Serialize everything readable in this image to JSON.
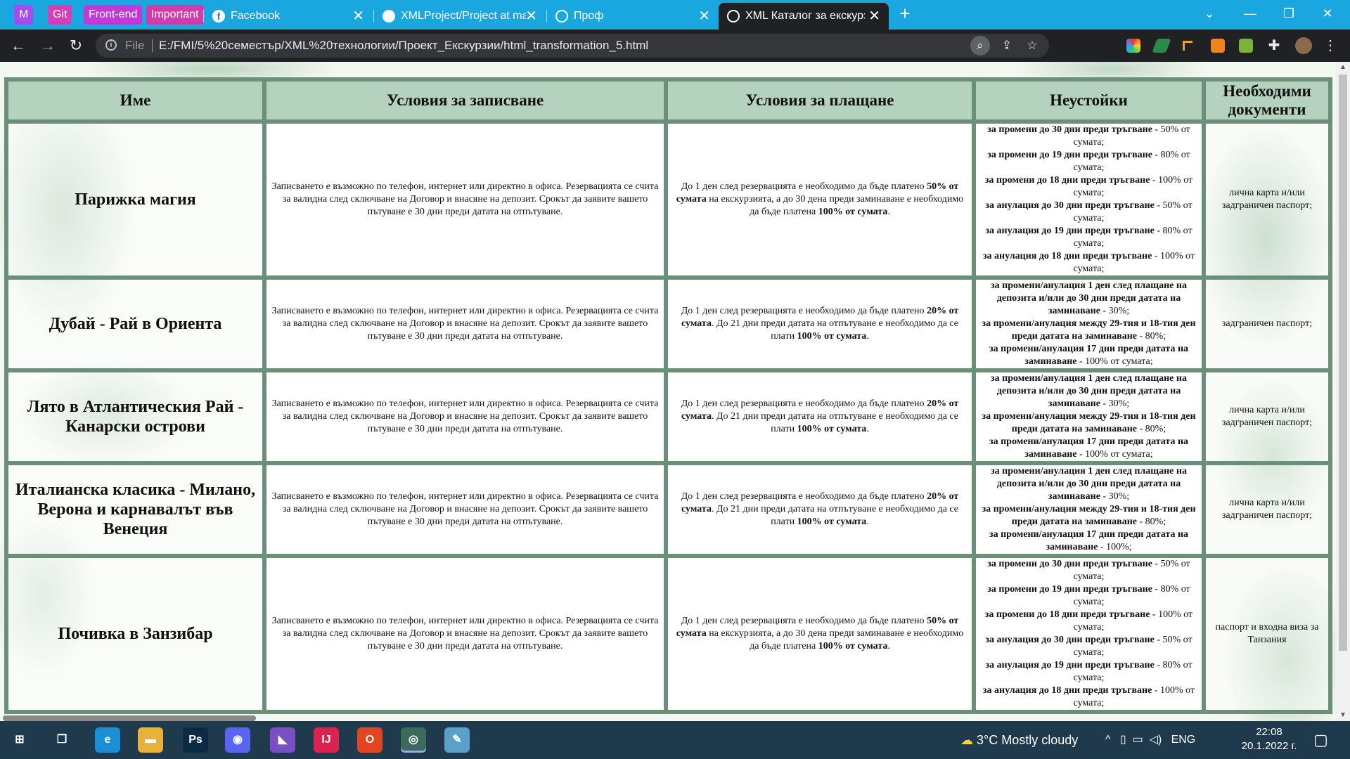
{
  "browser": {
    "bookmarks": [
      {
        "label": "M",
        "color": "#a64bf4"
      },
      {
        "label": "Git",
        "color": "#d63eb8"
      },
      {
        "label": "Front-end",
        "color": "#c239d9"
      },
      {
        "label": "Important",
        "color": "#d13cad"
      }
    ],
    "tabs": [
      {
        "title": "Facebook",
        "icon": "facebook-icon",
        "active": false
      },
      {
        "title": "XMLProject/Project at main · Vesi",
        "icon": "github-icon",
        "active": false
      },
      {
        "title": "Проф",
        "icon": "globe-icon",
        "active": false
      },
      {
        "title": "XML Каталог за екскурзии",
        "icon": "globe-icon",
        "active": true
      }
    ],
    "new_tab": "+",
    "close_glyph": "✕",
    "window_controls": [
      "⌄",
      "—",
      "❐",
      "✕"
    ],
    "nav": {
      "back": "←",
      "forward": "→",
      "reload": "↻"
    },
    "address": {
      "scheme_label": "File",
      "url": "E:/FMI/5%20семестър/XML%20технологии/Проект_Екскурзии/html_transformation_5.html"
    }
  },
  "table": {
    "headers": [
      "Име",
      "Условия за записване",
      "Условия за плащане",
      "Неустойки",
      "Необходими документи"
    ],
    "rows": [
      {
        "name": "Парижка магия",
        "enrollment": "Записването е възможно по телефон, интернет или директно в офиса. Резервацията се счита за валидна след сключване на Договор и внасяне на депозит. Срокът да заявите вашето пътуване е 30 дни преди датата на отпътуване.",
        "payment": [
          {
            "t": "До 1 ден след резервацията е необходимо да бъде платено "
          },
          {
            "t": "50% от сумата",
            "b": true
          },
          {
            "t": " на екскурзията, а до 30 дена преди заминаване е необходимо да бъде платена "
          },
          {
            "t": "100% от сумата",
            "b": true
          },
          {
            "t": "."
          }
        ],
        "fees": [
          {
            "cond": "за промени до 30 дни преди тръгване",
            "val": " - 50% от сумата;"
          },
          {
            "cond": "за промени до 19 дни преди тръгване",
            "val": " - 80% от сумата;"
          },
          {
            "cond": "за промени до 18 дни преди тръгване",
            "val": " - 100% от сумата;"
          },
          {
            "cond": "за анулация до 30 дни преди тръгване",
            "val": " - 50% от сумата;"
          },
          {
            "cond": "за анулация до 19 дни преди тръгване",
            "val": " - 80% от сумата;"
          },
          {
            "cond": "за анулация до 18 дни преди тръгване",
            "val": " - 100% от сумата;"
          }
        ],
        "documents": "лична карта и/или задграничен паспорт;"
      },
      {
        "name": "Дубай - Рай в Ориента",
        "enrollment": "Записването е възможно по телефон, интернет или директно в офиса. Резервацията се счита за валидна след сключване на Договор и внасяне на депозит. Срокът да заявите вашето пътуване е 30 дни преди датата на отпътуване.",
        "payment": [
          {
            "t": "До 1 ден след резервацията е необходимо да бъде платено "
          },
          {
            "t": "20% от сумата",
            "b": true
          },
          {
            "t": ". До 21 дни преди датата на отпътуване е необходимо да се плати "
          },
          {
            "t": "100% от сумата",
            "b": true
          },
          {
            "t": "."
          }
        ],
        "fees": [
          {
            "cond": "за промени/анулация 1 ден след плащане на депозита и/или до 30 дни преди датата на заминаване",
            "val": " - 30%;"
          },
          {
            "cond": "за промени/анулация между 29-тия и 18-тия ден преди датата на заминаване",
            "val": " - 80%;"
          },
          {
            "cond": "за промени/анулация 17 дни преди датата на заминаване",
            "val": " - 100% от сумата;"
          }
        ],
        "documents": "задграничен паспорт;"
      },
      {
        "name": "Лято в Атлантическия Рай - Канарски острови",
        "enrollment": "Записването е възможно по телефон, интернет или директно в офиса. Резервацията се счита за валидна след сключване на Договор и внасяне на депозит. Срокът да заявите вашето пътуване е 30 дни преди датата на отпътуване.",
        "payment": [
          {
            "t": "До 1 ден след резервацията е необходимо да бъде платено "
          },
          {
            "t": "20% от сумата",
            "b": true
          },
          {
            "t": ". До 21 дни преди датата на отпътуване е необходимо да се плати "
          },
          {
            "t": "100% от сумата",
            "b": true
          },
          {
            "t": "."
          }
        ],
        "fees": [
          {
            "cond": "за промени/анулация 1 ден след плащане на депозита и/или до 30 дни преди датата на заминаване",
            "val": " - 30%;"
          },
          {
            "cond": "за промени/анулация между 29-тия и 18-тия ден преди датата на заминаване",
            "val": " - 80%;"
          },
          {
            "cond": "за промени/анулация 17 дни преди датата на заминаване",
            "val": " - 100% от сумата;"
          }
        ],
        "documents": "лична карта и/или задграничен паспорт;"
      },
      {
        "name": "Италианска класика - Милано, Верона и карнавалът във Венеция",
        "enrollment": "Записването е възможно по телефон, интернет или директно в офиса. Резервацията се счита за валидна след сключване на Договор и внасяне на депозит. Срокът да заявите вашето пътуване е 30 дни преди датата на отпътуване.",
        "payment": [
          {
            "t": "До 1 ден след резервацията е необходимо да бъде платено "
          },
          {
            "t": "20% от сумата",
            "b": true
          },
          {
            "t": ". До 21 дни преди датата на отпътуване е необходимо да се плати "
          },
          {
            "t": "100% от сумата",
            "b": true
          },
          {
            "t": "."
          }
        ],
        "fees": [
          {
            "cond": "за промени/анулация 1 ден след плащане на депозита и/или до 30 дни преди датата на заминаване",
            "val": " - 30%;"
          },
          {
            "cond": "за промени/анулация между 29-тия и 18-тия ден преди датата на заминаване",
            "val": " - 80%;"
          },
          {
            "cond": "за промени/анулация 17 дни преди датата на заминаване",
            "val": " - 100%;"
          }
        ],
        "documents": "лична карта и/или задграничен паспорт;"
      },
      {
        "name": "Почивка в Занзибар",
        "enrollment": "Записването е възможно по телефон, интернет или директно в офиса. Резервацията се счита за валидна след сключване на Договор и внасяне на депозит. Срокът да заявите вашето пътуване е 30 дни преди датата на отпътуване.",
        "payment": [
          {
            "t": "До 1 ден след резервацията е необходимо да бъде платено "
          },
          {
            "t": "50% от сумата",
            "b": true
          },
          {
            "t": " на екскурзията, а до 30 дена преди заминаване е необходимо да бъде платена "
          },
          {
            "t": "100% от сумата",
            "b": true
          },
          {
            "t": "."
          }
        ],
        "fees": [
          {
            "cond": "за промени до 30 дни преди тръгване",
            "val": " - 50% от сумата;"
          },
          {
            "cond": "за промени до 19 дни преди тръгване",
            "val": " - 80% от сумата;"
          },
          {
            "cond": "за промени до 18 дни преди тръгване",
            "val": " - 100% от сумата;"
          },
          {
            "cond": "за анулация до 30 дни преди тръгване",
            "val": " - 50% от сумата;"
          },
          {
            "cond": "за анулация до 19 дни преди тръгване",
            "val": " - 80% от сумата;"
          },
          {
            "cond": "за анулация до 18 дни преди тръгване",
            "val": " - 100% от сумата;"
          }
        ],
        "documents": "паспорт и входна виза за Танзания"
      }
    ]
  },
  "taskbar": {
    "apps": [
      {
        "name": "start-button",
        "glyph": "⊞",
        "color": "transparent"
      },
      {
        "name": "task-view-button",
        "glyph": "❒",
        "color": "transparent"
      },
      {
        "name": "edge-app",
        "glyph": "e",
        "color": "#1b8fd6"
      },
      {
        "name": "file-explorer-app",
        "glyph": "▬",
        "color": "#e8b23a"
      },
      {
        "name": "photoshop-app",
        "glyph": "Ps",
        "color": "#0b2a44"
      },
      {
        "name": "discord-app",
        "glyph": "◉",
        "color": "#5865f2"
      },
      {
        "name": "visual-studio-app",
        "glyph": "◣",
        "color": "#7b4fc4"
      },
      {
        "name": "intellij-app",
        "glyph": "IJ",
        "color": "#d8244f"
      },
      {
        "name": "office-app",
        "glyph": "O",
        "color": "#e2451f"
      },
      {
        "name": "chrome-app",
        "glyph": "◎",
        "color": "#3b6b5a"
      },
      {
        "name": "paint-app",
        "glyph": "✎",
        "color": "#5aa0c8"
      }
    ],
    "weather": {
      "temp": "3°C",
      "text": "Mostly cloudy"
    },
    "language": "ENG",
    "time": "22:08",
    "date": "20.1.2022 г."
  }
}
